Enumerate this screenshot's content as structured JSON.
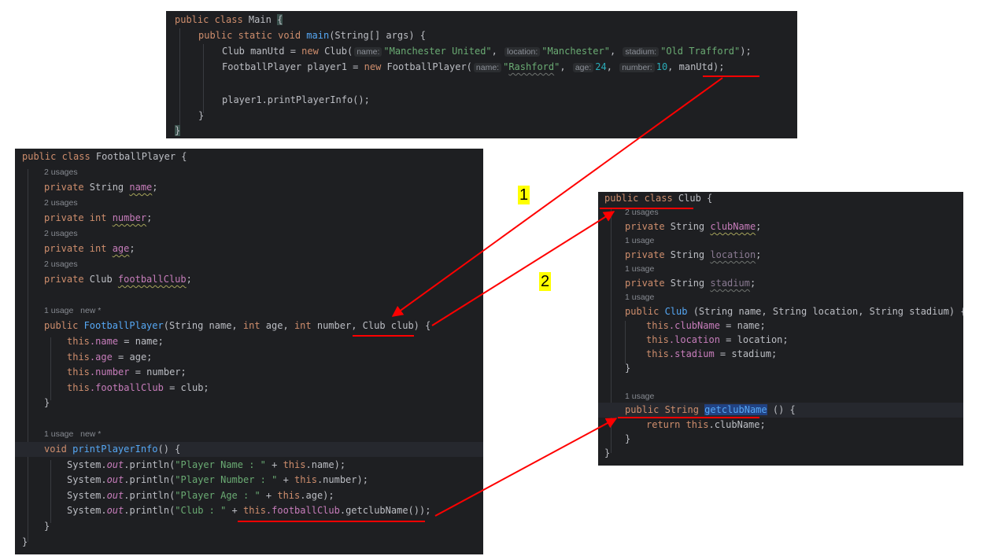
{
  "main_panel": {
    "lines": [
      {
        "k1": "public class ",
        "name": "Main",
        "open": "{"
      },
      {
        "k1": "public static void ",
        "fn": "main",
        "rest": "(String[] args) {"
      },
      {
        "pre": "Club manUtd = ",
        "k": "new",
        "call": " Club(",
        "h1": "name:",
        "s1": "\"Manchester United\"",
        "c1": ",",
        "h2": "location:",
        "s2": "\"Manchester\"",
        "c2": ",",
        "h3": "stadium:",
        "s3": "\"Old Trafford\"",
        "end": ");"
      },
      {
        "pre": "FootballPlayer player1 = ",
        "k": "new",
        "call": " FootballPlayer(",
        "h1": "name:",
        "s1q1": "\"",
        "s1": "Rashford",
        "s1q2": "\"",
        "c1": ",",
        "h2": "age:",
        "n2": "24",
        "c2": ",",
        "h3": "number:",
        "n3": "10",
        "c3": ", manUtd);"
      },
      {
        "text": "player1.printPlayerInfo();"
      },
      {
        "text": "}"
      },
      {
        "text": "}"
      }
    ]
  },
  "player_panel": {
    "class_kw": "public class ",
    "class_name": "FootballPlayer {",
    "usage_2": "2 usages",
    "usage_new": "1 usage   new *",
    "kw_private": "private ",
    "t_string": "String ",
    "t_int": "int ",
    "t_club": "Club ",
    "f_name": "name",
    "f_number": "number",
    "f_age": "age",
    "f_club": "footballClub",
    "semi": ";",
    "ctor_kw": "public ",
    "ctor_name": "FootballPlayer",
    "ctor_p1": "(String name, ",
    "ctor_int1": "int",
    "ctor_p2": " age, ",
    "ctor_int2": "int",
    "ctor_p3": " number, Club club) {",
    "this_kw": "this",
    "assign_name": " = name;",
    "assign_age": " = age;",
    "assign_number": " = number;",
    "assign_club": " = club;",
    "close": "}",
    "void_kw": "void ",
    "method_name": "printPlayerInfo",
    "method_rest": "() {",
    "sys": "System.",
    "out": "out",
    "println": ".println(",
    "s_name": "\"Player Name : \"",
    "s_number": "\"Player Number : \"",
    "s_age": "\"Player Age : \"",
    "s_club": "\"Club : \"",
    "plus": " + ",
    "dot_name": ".name);",
    "dot_number": ".number);",
    "dot_age": ".age);",
    "dot_club": ".footballClub",
    "getclub_call": ".getclubName());"
  },
  "club_panel": {
    "class_decl": "public class ",
    "class_name": "Club {",
    "usage_2": "2 usages",
    "usage_1": "1 usage",
    "kw_private": "private ",
    "t_string": "String ",
    "f_clubName": "clubName",
    "f_location": "location",
    "f_stadium": "stadium",
    "semi": ";",
    "ctor_kw": "public ",
    "ctor_name": "Club",
    "ctor_rest": " (String name, String location, String stadium) {",
    "this_kw": "this",
    "a_clubName": ".clubName",
    "a_location": ".location",
    "a_stadium": ".stadium",
    "eq_name": " = name;",
    "eq_location": " = location;",
    "eq_stadium": " = stadium;",
    "close": "}",
    "getter_kw": "public String ",
    "getter_name": "getclubName",
    "getter_rest": " () {",
    "return_kw": "return ",
    "return_rest": ".clubName;"
  },
  "annotations": {
    "label_1": "1",
    "label_2": "2",
    "arrow_color": "#ff0000",
    "badge_color": "#ffff00"
  }
}
